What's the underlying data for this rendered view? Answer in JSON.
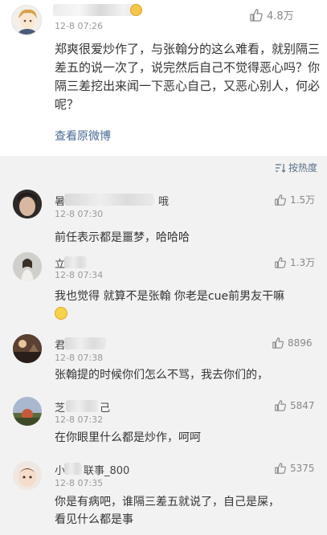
{
  "main_comment": {
    "name_visible": "",
    "time": "12-8 07:26",
    "likes": "4.8万",
    "text": "郑爽很爱炒作了，与张翰分的这么难看，就别隔三差五的说一次了，说完然后自己不觉得恶心吗？你隔三差挖出来闻一下恶心自己，又恶心别人，何必呢？",
    "view_original": "查看原微博"
  },
  "sort": {
    "label": "按热度"
  },
  "replies": [
    {
      "name_prefix": "暑",
      "name_suffix": "哦",
      "time": "12-8 07:30",
      "likes": "1.5万",
      "text": "前任表示都是噩梦，哈哈哈"
    },
    {
      "name_prefix": "立",
      "name_suffix": "",
      "time": "12-8 07:34",
      "likes": "1.3万",
      "text": "我也觉得 就算不是张翰 你老是cue前男友干嘛"
    },
    {
      "name_prefix": "君",
      "name_suffix": "",
      "time": "12-8 07:38",
      "likes": "8896",
      "text": "张翰提的时候你们怎么不骂，我去你们的，"
    },
    {
      "name_prefix": "芝",
      "name_suffix": "己",
      "time": "12-8 07:32",
      "likes": "5847",
      "text": "在你眼里什么都是炒作，呵呵"
    },
    {
      "name_prefix": "小",
      "name_suffix": "联事_800",
      "time": "12-8 07:35",
      "likes": "5375",
      "text_line1": "你是有病吧，谁隔三差五就说了，自己是屎，",
      "text_line2": "看见什么都是事"
    }
  ],
  "colors": {
    "link": "#4a6a96",
    "time": "#999999",
    "background": "#f2f2f2"
  },
  "icons": [
    "thumbs-up-icon",
    "sort-icon",
    "emoji-icon"
  ]
}
